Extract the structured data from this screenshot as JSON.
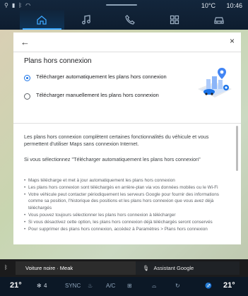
{
  "status": {
    "temperature": "10°C",
    "time": "10:46"
  },
  "nav": {
    "tabs": [
      {
        "name": "home",
        "icon": "home-icon",
        "active": true
      },
      {
        "name": "music",
        "icon": "music-note-icon",
        "active": false
      },
      {
        "name": "phone",
        "icon": "phone-icon",
        "active": false
      },
      {
        "name": "apps",
        "icon": "apps-grid-icon",
        "active": false
      },
      {
        "name": "vehicle",
        "icon": "car-icon",
        "active": false
      }
    ]
  },
  "dialog": {
    "back_glyph": "←",
    "close_glyph": "×",
    "title": "Plans hors connexion",
    "option_auto": "Télécharger automatiquement les plans hors connexion",
    "option_manual": "Télécharger manuellement les plans hors connexion",
    "selected_option": "auto",
    "intro": "Les plans hors connexion complètent certaines fonctionnalités du véhicule et vous permettent d'utiliser Maps sans connexion Internet.",
    "if_selected": "Si vous sélectionnez \"Télécharger automatiquement les plans hors connexion\"",
    "bullets": [
      "Maps télécharge et met à jour automatiquement les plans hors connexion",
      "Les plans hors connexion sont téléchargés en arrière-plan via vos données mobiles ou le Wi-Fi",
      "Votre véhicule peut contacter périodiquement les serveurs Google pour fournir des informations comme sa position, l'historique des positions et les plans hors connexion que vous avez déjà téléchargés",
      "Vous pouvez toujours sélectionner les plans hors connexion à télécharger",
      "Si vous désactivez cette option, les plans hors connexion déjà téléchargés seront conservés",
      "Pour supprimer des plans hors connexion, accédez à Paramètres > Plans hors connexion"
    ]
  },
  "media": {
    "source": "Voiture noire · Meak",
    "assistant": "Assistant Google"
  },
  "climate": {
    "left_temp": "21°",
    "fan": "4",
    "sync": "SYNC",
    "ac": "A/C",
    "right_temp": "21°"
  },
  "colors": {
    "accent": "#3da8ff",
    "radio_selected": "#1a73e8"
  }
}
